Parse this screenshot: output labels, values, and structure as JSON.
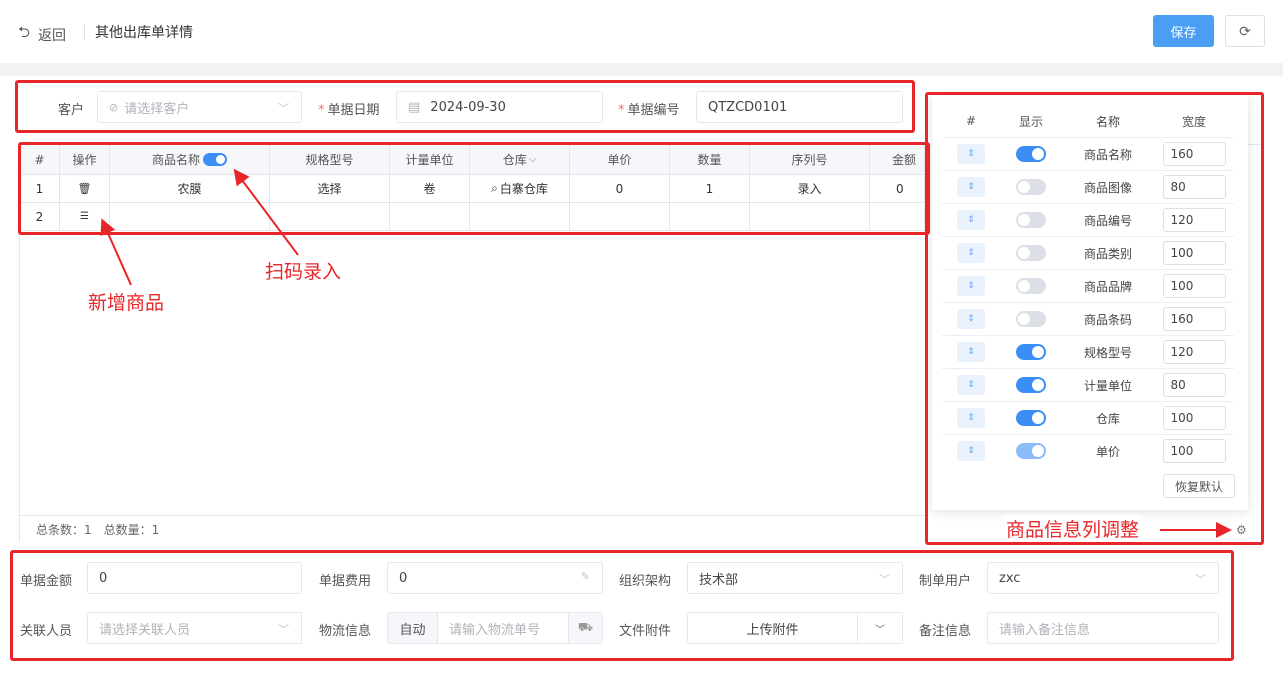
{
  "header": {
    "back_label": "返回",
    "title": "其他出库单详情",
    "save_label": "保存",
    "back_icon": "undo-arrow-icon",
    "refresh_icon": "refresh-icon"
  },
  "top_form": {
    "customer_label": "客户",
    "customer_placeholder": "请选择客户",
    "date_label": "单据日期",
    "date_value": "2024-09-30",
    "number_label": "单据编号",
    "number_value": "QTZCD0101",
    "required_mark": "*"
  },
  "table": {
    "columns": [
      "#",
      "操作",
      "商品名称",
      "规格型号",
      "计量单位",
      "仓库",
      "单价",
      "数量",
      "序列号",
      "金额"
    ],
    "rows": [
      {
        "index": "1",
        "name": "农膜",
        "spec": "选择",
        "unit": "卷",
        "warehouse": "白寨仓库",
        "price": "0",
        "qty": "1",
        "serial": "录入",
        "amount": "0"
      },
      {
        "index": "2",
        "name": "",
        "spec": "",
        "unit": "",
        "warehouse": "",
        "price": "",
        "qty": "",
        "serial": "",
        "amount": ""
      }
    ],
    "summary": {
      "count_label": "总条数：",
      "count": "1",
      "qty_label": "总数量：",
      "qty": "1"
    }
  },
  "annotations": {
    "scan": "扫码录入",
    "add": "新增商品",
    "columns": "商品信息列调整"
  },
  "column_panel": {
    "headers": [
      "#",
      "显示",
      "名称",
      "宽度"
    ],
    "rows": [
      {
        "name": "商品名称",
        "visible": true,
        "width": "160"
      },
      {
        "name": "商品图像",
        "visible": false,
        "width": "80"
      },
      {
        "name": "商品编号",
        "visible": false,
        "width": "120"
      },
      {
        "name": "商品类别",
        "visible": false,
        "width": "100"
      },
      {
        "name": "商品品牌",
        "visible": false,
        "width": "100"
      },
      {
        "name": "商品条码",
        "visible": false,
        "width": "160"
      },
      {
        "name": "规格型号",
        "visible": true,
        "width": "120"
      },
      {
        "name": "计量单位",
        "visible": true,
        "width": "80"
      },
      {
        "name": "仓库",
        "visible": true,
        "width": "100"
      },
      {
        "name": "单价",
        "visible": true,
        "width": "100"
      }
    ],
    "reset_label": "恢复默认"
  },
  "bottom_form": {
    "amount_label": "单据金额",
    "amount_value": "0",
    "fee_label": "单据费用",
    "fee_value": "0",
    "org_label": "组织架构",
    "org_value": "技术部",
    "creator_label": "制单用户",
    "creator_value": "zxc",
    "related_label": "关联人员",
    "related_placeholder": "请选择关联人员",
    "logistics_label": "物流信息",
    "logistics_auto": "自动",
    "logistics_placeholder": "请输入物流单号",
    "attach_label": "文件附件",
    "attach_button": "上传附件",
    "remark_label": "备注信息",
    "remark_placeholder": "请输入备注信息"
  },
  "colors": {
    "primary": "#4a9ff5",
    "annotation": "#e8262a",
    "required": "#f56c6c"
  }
}
